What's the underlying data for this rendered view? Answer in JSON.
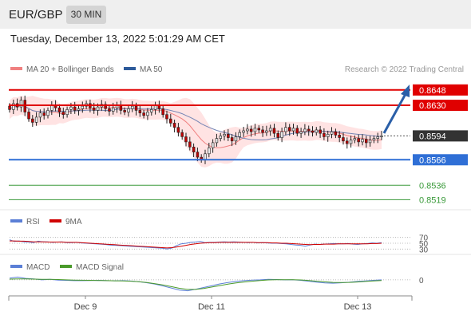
{
  "header": {
    "symbol": "EUR/GBP",
    "timeframe": "30 MIN"
  },
  "datetime": "Tuesday, December 13, 2022 5:01:29 AM CET",
  "legend": {
    "ma20_label": "MA 20 + Bollinger Bands",
    "ma50_label": "MA 50",
    "copyright": "Research © 2022 Trading Central"
  },
  "colors": {
    "resistance": "#e00000",
    "support": "#2f6fd6",
    "target": "#3a9a3a",
    "current": "#333333",
    "forecast_arrow": "#2a5fa8",
    "bollinger_fill": "#ffdada",
    "ma20": "#f08080",
    "ma50": "#7585b5",
    "candle_up": "#e8e8e8",
    "candle_down": "#c00000",
    "rsi": "#5b7fd6",
    "rsi_ma": "#d00000",
    "macd": "#5b7fd6",
    "macd_signal": "#4a9a2a"
  },
  "chart_data": [
    {
      "type": "candlestick",
      "name": "price",
      "x_labels": [
        "Dec 9",
        "Dec 11",
        "Dec 13"
      ],
      "ylim": [
        0.851,
        0.866
      ],
      "levels": [
        {
          "value": "0.8648",
          "kind": "resistance"
        },
        {
          "value": "0.8630",
          "kind": "resistance"
        },
        {
          "value": "0.8594",
          "kind": "current"
        },
        {
          "value": "0.8566",
          "kind": "support"
        },
        {
          "value": "0.8536",
          "kind": "target"
        },
        {
          "value": "0.8519",
          "kind": "target"
        }
      ],
      "close": [
        0.8625,
        0.8632,
        0.8628,
        0.8636,
        0.8622,
        0.8614,
        0.861,
        0.8616,
        0.8621,
        0.8618,
        0.8624,
        0.863,
        0.8627,
        0.8622,
        0.8619,
        0.8625,
        0.8628,
        0.8624,
        0.8626,
        0.8629,
        0.8632,
        0.8627,
        0.8624,
        0.8628,
        0.8631,
        0.8626,
        0.8623,
        0.8627,
        0.863,
        0.8624,
        0.8622,
        0.8626,
        0.8629,
        0.8624,
        0.8621,
        0.8618,
        0.8622,
        0.8625,
        0.863,
        0.8626,
        0.8619,
        0.8614,
        0.8609,
        0.8604,
        0.8598,
        0.8593,
        0.8587,
        0.8581,
        0.8575,
        0.8569,
        0.8566,
        0.8573,
        0.858,
        0.8586,
        0.8591,
        0.8594,
        0.8596,
        0.8592,
        0.8588,
        0.8593,
        0.8598,
        0.86,
        0.8602,
        0.8599,
        0.8603,
        0.8601,
        0.8598,
        0.86,
        0.8603,
        0.8597,
        0.8592,
        0.8599,
        0.8604,
        0.86,
        0.8603,
        0.8597,
        0.8599,
        0.8602,
        0.86,
        0.8598,
        0.8601,
        0.8597,
        0.8593,
        0.8596,
        0.8599,
        0.8595,
        0.8592,
        0.8588,
        0.8585,
        0.8589,
        0.8591,
        0.8587,
        0.859,
        0.8586,
        0.8589,
        0.8591,
        0.8593,
        0.8594
      ]
    },
    {
      "type": "line",
      "name": "RSI",
      "legend": [
        "RSI",
        "9MA"
      ],
      "ticks": [
        "70",
        "50",
        "30"
      ],
      "ylim": [
        20,
        80
      ],
      "series": [
        {
          "name": "RSI",
          "values": [
            62,
            56,
            58,
            55,
            54,
            52,
            57,
            55,
            55,
            53,
            54,
            55,
            52,
            52,
            53,
            51,
            50,
            49,
            48,
            47,
            46,
            44,
            43,
            42,
            41,
            40,
            39,
            38,
            37,
            36,
            35,
            34,
            33,
            30,
            33,
            42,
            48,
            50,
            53,
            54,
            56,
            52,
            53,
            53,
            54,
            55,
            54,
            55,
            54,
            53,
            52,
            53,
            51,
            52,
            51,
            50,
            50,
            49,
            48,
            46,
            44,
            43,
            40,
            44,
            47,
            46,
            47,
            48,
            49,
            48,
            48,
            49,
            47,
            46,
            48,
            49,
            51,
            50,
            52
          ]
        },
        {
          "name": "9MA",
          "values": [
            58,
            58,
            57,
            57,
            56,
            55,
            55,
            55,
            54,
            54,
            54,
            54,
            53,
            53,
            53,
            52,
            51,
            50,
            49,
            48,
            47,
            46,
            45,
            44,
            43,
            42,
            41,
            40,
            39,
            38,
            37,
            36,
            35,
            34,
            35,
            37,
            40,
            43,
            46,
            48,
            50,
            51,
            52,
            52,
            53,
            53,
            53,
            53,
            53,
            53,
            53,
            53,
            52,
            52,
            52,
            51,
            51,
            50,
            50,
            49,
            48,
            47,
            46,
            45,
            46,
            46,
            47,
            47,
            47,
            48,
            48,
            48,
            48,
            48,
            48,
            48,
            49,
            49,
            50
          ]
        }
      ]
    },
    {
      "type": "line",
      "name": "MACD",
      "legend": [
        "MACD",
        "MACD Signal"
      ],
      "ticks": [
        "0"
      ],
      "ylim": [
        -10,
        4
      ],
      "series": [
        {
          "name": "MACD",
          "values": [
            1.2,
            2.0,
            1.0,
            0.6,
            0.0,
            0.3,
            -0.2,
            -0.4,
            -0.6,
            -0.6,
            -0.5,
            -0.4,
            -0.6,
            -0.7,
            -0.6,
            -0.9,
            -1.4,
            -2.2,
            -3.2,
            -4.6,
            -6.0,
            -7.5,
            -8.0,
            -6.9,
            -5.6,
            -4.3,
            -3.0,
            -2.0,
            -1.2,
            -0.6,
            -0.2,
            0.0,
            0.3,
            0.2,
            0.0,
            0.1,
            -0.4,
            -1.0,
            -1.8,
            -2.3,
            -2.5,
            -2.2,
            -1.8,
            -1.2,
            -0.8,
            -0.4,
            0.0
          ]
        },
        {
          "name": "MACD Signal",
          "values": [
            0.5,
            0.7,
            0.6,
            0.5,
            0.4,
            0.3,
            0.2,
            0.0,
            -0.2,
            -0.3,
            -0.4,
            -0.5,
            -0.6,
            -0.7,
            -0.8,
            -1.0,
            -1.4,
            -2.0,
            -2.8,
            -3.8,
            -5.0,
            -6.2,
            -7.0,
            -7.0,
            -6.3,
            -5.3,
            -4.2,
            -3.2,
            -2.3,
            -1.6,
            -1.0,
            -0.5,
            -0.1,
            0.1,
            0.1,
            0.1,
            -0.1,
            -0.5,
            -1.0,
            -1.5,
            -1.9,
            -2.0,
            -1.9,
            -1.6,
            -1.2,
            -0.8,
            -0.5
          ]
        }
      ]
    }
  ]
}
